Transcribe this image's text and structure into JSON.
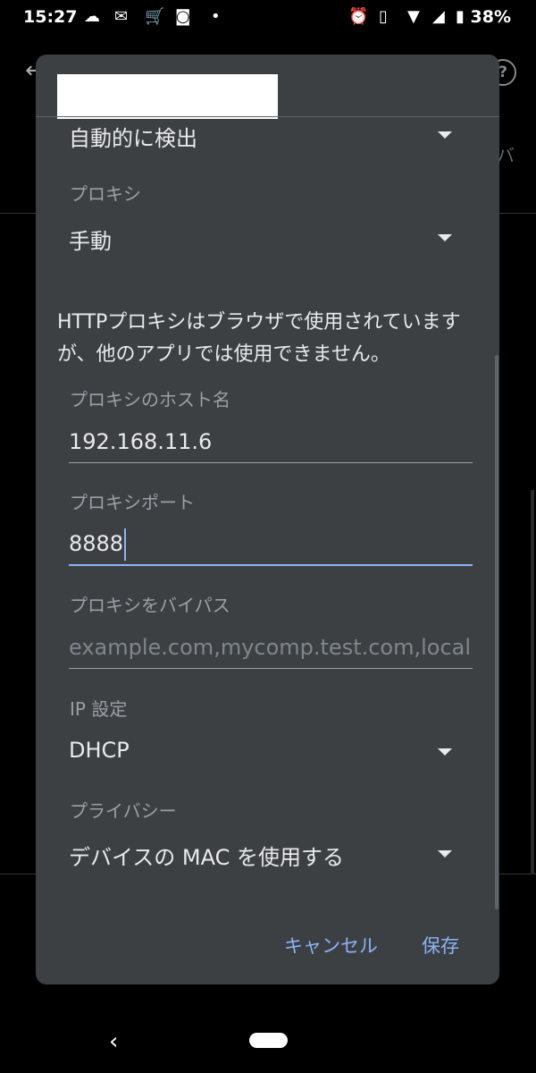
{
  "status_bar": {
    "time": "15:27",
    "battery_pct": "38%",
    "icons": [
      "weather-icon",
      "gmail-icon",
      "cart-icon",
      "app-icon",
      "dot-icon",
      "alarm-icon",
      "vibrate-icon",
      "wifi-icon",
      "signal-icon",
      "battery-icon"
    ]
  },
  "dialog": {
    "proxy_auto_value": "自動的に検出",
    "proxy": {
      "label": "プロキシ",
      "value": "手動"
    },
    "notice": "HTTPプロキシはブラウザで使用されていますが、他のアプリでは使用できません。",
    "proxy_host": {
      "label": "プロキシのホスト名",
      "value": "192.168.11.6"
    },
    "proxy_port": {
      "label": "プロキシポート",
      "value": "8888"
    },
    "proxy_bypass": {
      "label": "プロキシをバイパス",
      "placeholder": "example.com,mycomp.test.com,localhost"
    },
    "ip_settings": {
      "label": "IP 設定",
      "value": "DHCP"
    },
    "privacy": {
      "label": "プライバシー",
      "value": "デバイスの MAC を使用する"
    },
    "buttons": {
      "cancel": "キャンセル",
      "save": "保存"
    }
  },
  "background": {
    "partial_text": "バ"
  },
  "colors": {
    "dialog_bg": "#3c4043",
    "accent": "#8ab4f8",
    "text": "#e8eaed",
    "secondary": "#9aa0a6"
  }
}
